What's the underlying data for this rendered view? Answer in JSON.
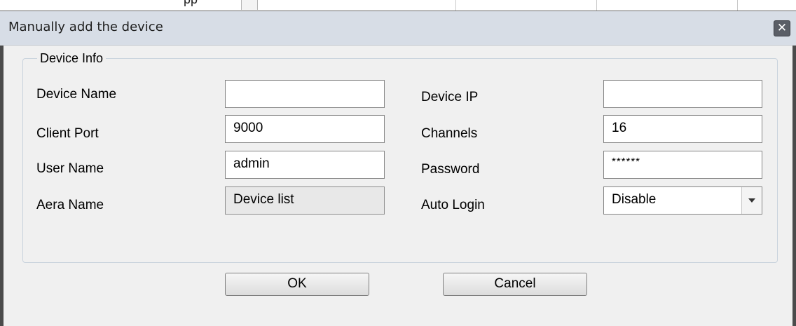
{
  "background_window": {
    "partial_text": "pp"
  },
  "dialog": {
    "title": "Manually add the device",
    "close_glyph": "✕",
    "group_title": "Device Info",
    "fields": {
      "device_name": {
        "label": "Device Name",
        "value": ""
      },
      "device_ip": {
        "label": "Device IP",
        "value": ""
      },
      "client_port": {
        "label": "Client Port",
        "value": "9000"
      },
      "channels": {
        "label": "Channels",
        "value": "16"
      },
      "user_name": {
        "label": "User Name",
        "value": "admin"
      },
      "password": {
        "label": "Password",
        "value": "******"
      },
      "area_name": {
        "label": "Aera Name",
        "value": "Device list"
      },
      "auto_login": {
        "label": "Auto Login",
        "value": "Disable"
      }
    },
    "buttons": {
      "ok": "OK",
      "cancel": "Cancel"
    }
  },
  "colors": {
    "titlebar": "#d7dde6",
    "frame": "#4b4b4b",
    "dialog_bg": "#f0f0f0",
    "close_button": "#5a5e66"
  }
}
